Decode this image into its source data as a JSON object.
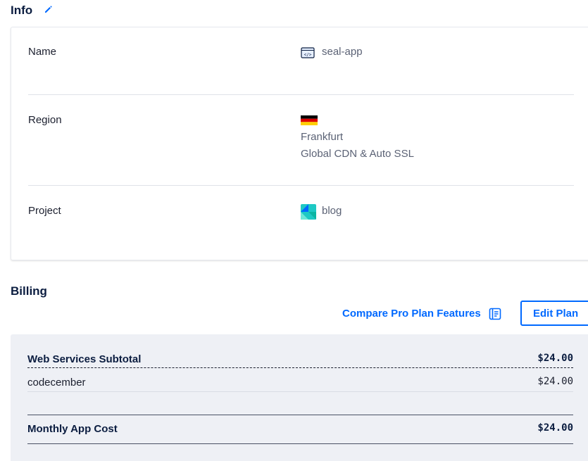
{
  "info": {
    "title": "Info",
    "rows": [
      {
        "label": "Name",
        "value": "seal-app",
        "icon": "app-code-icon"
      },
      {
        "label": "Region",
        "flag": "germany-flag-icon",
        "lines": [
          "Frankfurt",
          "Global CDN & Auto SSL"
        ]
      },
      {
        "label": "Project",
        "value": "blog",
        "icon": "project-icon"
      }
    ]
  },
  "billing": {
    "title": "Billing",
    "compare_link": "Compare Pro Plan Features",
    "edit_plan": "Edit Plan",
    "subtotal_label": "Web Services Subtotal",
    "subtotal_amount": "$24.00",
    "items": [
      {
        "label": "codecember",
        "amount": "$24.00"
      }
    ],
    "total_label": "Monthly App Cost",
    "total_amount": "$24.00"
  },
  "colors": {
    "accent": "#0069ff",
    "heading": "#0b1d40",
    "billing_bg": "#eef0f5"
  }
}
